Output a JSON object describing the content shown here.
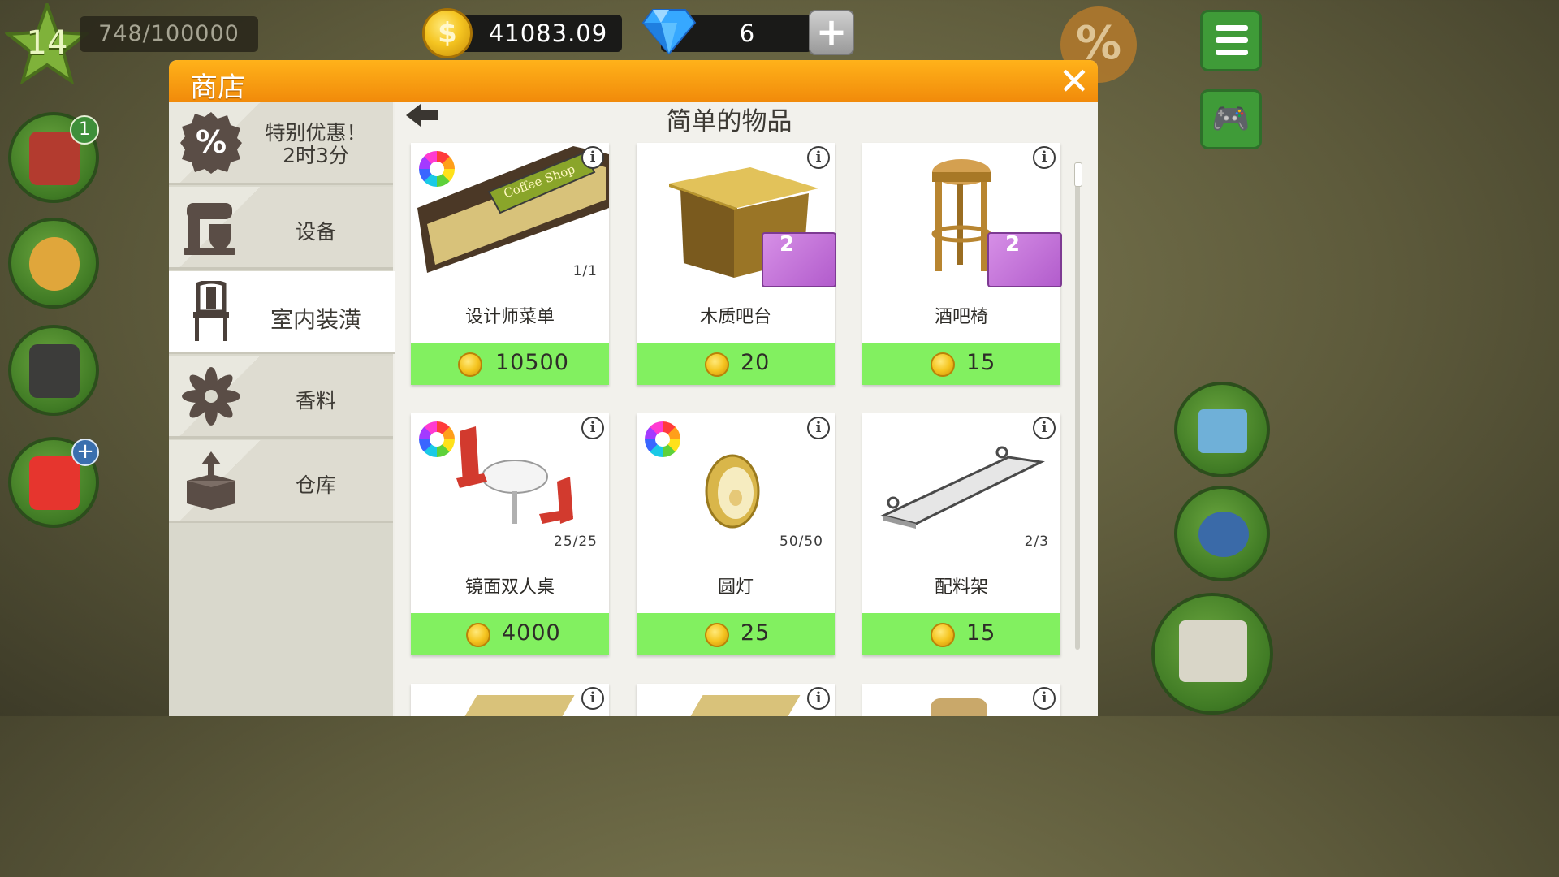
{
  "hud": {
    "level": "14",
    "xp": "748/100000",
    "coins": "41083.09",
    "gems": "6",
    "plus_label": "+",
    "sale_label": "%"
  },
  "shop": {
    "title": "商店",
    "close_label": "✕",
    "section_title": "简单的物品",
    "categories": [
      {
        "label": "特别优惠！\n2时3分",
        "icon": "percent-icon"
      },
      {
        "label": "设备",
        "icon": "mixer-icon"
      },
      {
        "label": "室内装潢",
        "icon": "chair-icon",
        "active": true
      },
      {
        "label": "香料",
        "icon": "spice-flower-icon"
      },
      {
        "label": "仓库",
        "icon": "storage-box-icon"
      }
    ],
    "special_offer": "特别优惠！",
    "special_timer": "2时3分",
    "items": [
      {
        "name": "设计师菜单",
        "count": "1/1",
        "price": "10500",
        "color_options": true,
        "art_text": "Coffee Shop"
      },
      {
        "name": "木质吧台",
        "count": "",
        "price": "20",
        "color_options": false,
        "box_badge": "2"
      },
      {
        "name": "酒吧椅",
        "count": "",
        "price": "15",
        "color_options": false,
        "box_badge": "2"
      },
      {
        "name": "镜面双人桌",
        "count": "25/25",
        "price": "4000",
        "color_options": true
      },
      {
        "name": "圆灯",
        "count": "50/50",
        "price": "25",
        "color_options": true
      },
      {
        "name": "配料架",
        "count": "2/3",
        "price": "15",
        "color_options": false
      }
    ]
  },
  "colors": {
    "header_orange": "#f5960d",
    "price_green": "#82f060",
    "panel_bg": "#efeee8"
  }
}
